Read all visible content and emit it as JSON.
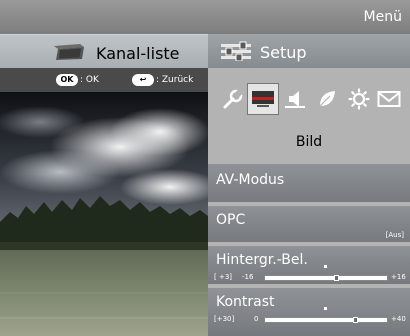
{
  "header": {
    "title": "Menü"
  },
  "tabs": [
    {
      "label": "Kanal-liste",
      "active": false
    },
    {
      "label": "Setup",
      "active": true
    }
  ],
  "hints": {
    "ok_key": "OK",
    "ok_text": ": OK",
    "back_key": "↩",
    "back_text": ": Zurück"
  },
  "categories": {
    "icons": [
      "wrench-icon",
      "monitor-icon",
      "speaker-icon",
      "leaf-icon",
      "sun-icon",
      "envelope-icon"
    ],
    "selected": "monitor-icon",
    "selected_label": "Bild"
  },
  "menu_items": [
    {
      "label": "AV-Modus"
    },
    {
      "label": "OPC",
      "value": "[Aus]"
    },
    {
      "label": "Hintergr.-Bel.",
      "current": "[ +3]",
      "min": "-16",
      "max": "+16",
      "level": 0.59
    },
    {
      "label": "Kontrast",
      "current": "[+30]",
      "min": "0",
      "max": "+40",
      "level": 0.75
    }
  ],
  "colors": {
    "menu_bar": "#8a8a8a",
    "panel": "#b3b3b3",
    "menu_item": "#84878b",
    "hint_bar": "#4a4a4a"
  }
}
